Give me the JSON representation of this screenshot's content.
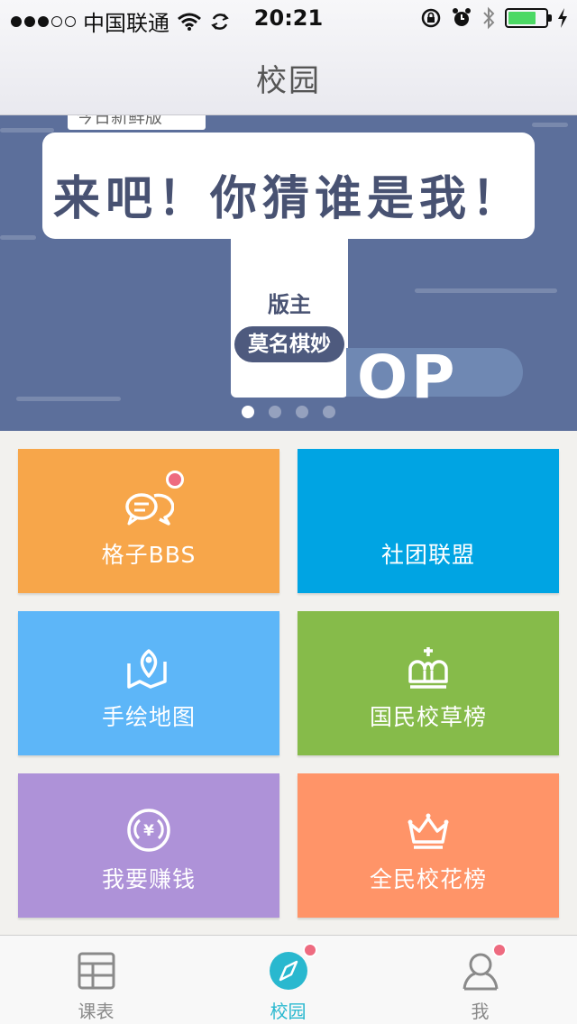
{
  "status_bar": {
    "carrier": "中国联通",
    "time": "20:21",
    "battery_color": "#4cd964"
  },
  "nav": {
    "title": "校园"
  },
  "banner": {
    "top_tag": "今日新鲜版",
    "headline": "来吧！你猜谁是我！",
    "moderator_label": "版主",
    "moderator_name": "莫名棋妙",
    "top_text": "OP",
    "pages": 4,
    "active_page": 1,
    "background_color": "#5c6f9b"
  },
  "tiles": [
    {
      "label": "格子BBS",
      "icon": "chat-bubbles-icon",
      "color": "#f7a64a",
      "has_badge": true
    },
    {
      "label": "社团联盟",
      "icon": "",
      "color": "#00a4e3",
      "has_badge": false
    },
    {
      "label": "手绘地图",
      "icon": "map-pin-icon",
      "color": "#5db6f8",
      "has_badge": false
    },
    {
      "label": "国民校草榜",
      "icon": "crown-cross-icon",
      "color": "#86bb4a",
      "has_badge": false
    },
    {
      "label": "我要赚钱",
      "icon": "yen-coin-icon",
      "color": "#ae92d8",
      "has_badge": false
    },
    {
      "label": "全民校花榜",
      "icon": "crown-icon",
      "color": "#ff9468",
      "has_badge": false
    }
  ],
  "tabbar": {
    "items": [
      {
        "label": "课表",
        "icon": "grid-table-icon",
        "active": false,
        "has_badge": false
      },
      {
        "label": "校园",
        "icon": "compass-icon",
        "active": true,
        "has_badge": true
      },
      {
        "label": "我",
        "icon": "person-icon",
        "active": false,
        "has_badge": true
      }
    ],
    "active_color": "#29b8cf"
  }
}
